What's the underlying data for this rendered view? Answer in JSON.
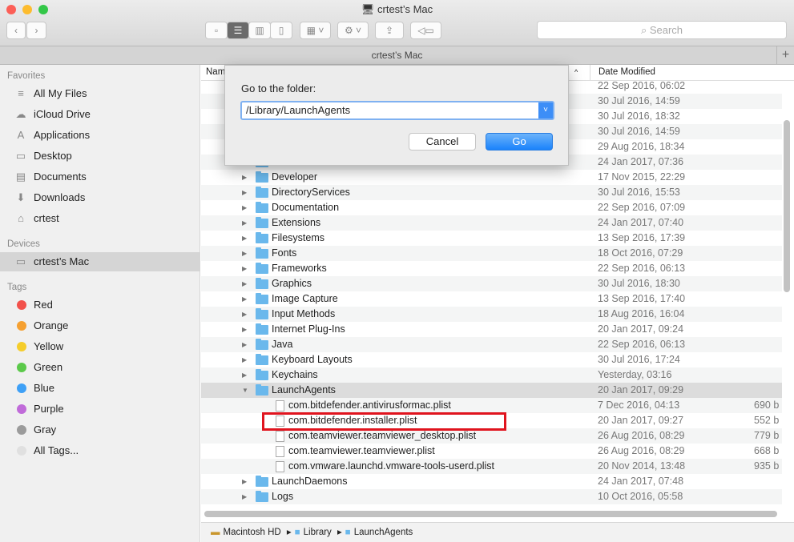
{
  "window": {
    "title": "crtest’s Mac",
    "tab": "crtest’s Mac",
    "search_placeholder": "Search"
  },
  "sidebar": {
    "favorites_header": "Favorites",
    "favorites": [
      {
        "label": "All My Files",
        "icon": "≡"
      },
      {
        "label": "iCloud Drive",
        "icon": "☁"
      },
      {
        "label": "Applications",
        "icon": "A"
      },
      {
        "label": "Desktop",
        "icon": "▭"
      },
      {
        "label": "Documents",
        "icon": "▤"
      },
      {
        "label": "Downloads",
        "icon": "⬇"
      },
      {
        "label": "crtest",
        "icon": "⌂"
      }
    ],
    "devices_header": "Devices",
    "devices": [
      {
        "label": "crtest’s Mac",
        "icon": "▭"
      }
    ],
    "tags_header": "Tags",
    "tags": [
      {
        "label": "Red",
        "color": "#f2514b"
      },
      {
        "label": "Orange",
        "color": "#f5a031"
      },
      {
        "label": "Yellow",
        "color": "#f5cd2b"
      },
      {
        "label": "Green",
        "color": "#5bc94a"
      },
      {
        "label": "Blue",
        "color": "#3ea0f6"
      },
      {
        "label": "Purple",
        "color": "#c06bd9"
      },
      {
        "label": "Gray",
        "color": "#9b9b9b"
      },
      {
        "label": "All Tags...",
        "color": "#e0e0e0"
      }
    ]
  },
  "columns": {
    "name": "Name",
    "date": "Date Modified"
  },
  "rows": [
    {
      "name": "",
      "date": "22 Sep 2016, 06:02",
      "size": "",
      "type": "folder"
    },
    {
      "name": "",
      "date": "30 Jul 2016, 14:59",
      "size": "",
      "type": "folder"
    },
    {
      "name": "",
      "date": "30 Jul 2016, 18:32",
      "size": "",
      "type": "folder"
    },
    {
      "name": "",
      "date": "30 Jul 2016, 14:59",
      "size": "",
      "type": "folder"
    },
    {
      "name": "",
      "date": "29 Aug 2016, 18:34",
      "size": "",
      "type": "folder"
    },
    {
      "name": "",
      "date": "24 Jan 2017, 07:36",
      "size": "",
      "type": "folder"
    },
    {
      "name": "Developer",
      "date": "17 Nov 2015, 22:29",
      "size": "",
      "type": "folder"
    },
    {
      "name": "DirectoryServices",
      "date": "30 Jul 2016, 15:53",
      "size": "",
      "type": "folder"
    },
    {
      "name": "Documentation",
      "date": "22 Sep 2016, 07:09",
      "size": "",
      "type": "folder"
    },
    {
      "name": "Extensions",
      "date": "24 Jan 2017, 07:40",
      "size": "",
      "type": "folder"
    },
    {
      "name": "Filesystems",
      "date": "13 Sep 2016, 17:39",
      "size": "",
      "type": "folder"
    },
    {
      "name": "Fonts",
      "date": "18 Oct 2016, 07:29",
      "size": "",
      "type": "folder"
    },
    {
      "name": "Frameworks",
      "date": "22 Sep 2016, 06:13",
      "size": "",
      "type": "folder"
    },
    {
      "name": "Graphics",
      "date": "30 Jul 2016, 18:30",
      "size": "",
      "type": "folder"
    },
    {
      "name": "Image Capture",
      "date": "13 Sep 2016, 17:40",
      "size": "",
      "type": "folder"
    },
    {
      "name": "Input Methods",
      "date": "18 Aug 2016, 16:04",
      "size": "",
      "type": "folder"
    },
    {
      "name": "Internet Plug-Ins",
      "date": "20 Jan 2017, 09:24",
      "size": "",
      "type": "folder"
    },
    {
      "name": "Java",
      "date": "22 Sep 2016, 06:13",
      "size": "",
      "type": "folder"
    },
    {
      "name": "Keyboard Layouts",
      "date": "30 Jul 2016, 17:24",
      "size": "",
      "type": "folder"
    },
    {
      "name": "Keychains",
      "date": "Yesterday, 03:16",
      "size": "",
      "type": "folder"
    },
    {
      "name": "LaunchAgents",
      "date": "20 Jan 2017, 09:29",
      "size": "",
      "type": "open"
    },
    {
      "name": "com.bitdefender.antivirusformac.plist",
      "date": "7 Dec 2016, 04:13",
      "size": "690 b",
      "type": "file"
    },
    {
      "name": "com.bitdefender.installer.plist",
      "date": "20 Jan 2017, 09:27",
      "size": "552 b",
      "type": "file"
    },
    {
      "name": "com.teamviewer.teamviewer_desktop.plist",
      "date": "26 Aug 2016, 08:29",
      "size": "779 b",
      "type": "file"
    },
    {
      "name": "com.teamviewer.teamviewer.plist",
      "date": "26 Aug 2016, 08:29",
      "size": "668 b",
      "type": "file"
    },
    {
      "name": "com.vmware.launchd.vmware-tools-userd.plist",
      "date": "20 Nov 2014, 13:48",
      "size": "935 b",
      "type": "file"
    },
    {
      "name": "LaunchDaemons",
      "date": "24 Jan 2017, 07:48",
      "size": "",
      "type": "folder"
    },
    {
      "name": "Logs",
      "date": "10 Oct 2016, 05:58",
      "size": "",
      "type": "folder"
    }
  ],
  "pathbar": [
    "Macintosh HD",
    "Library",
    "LaunchAgents"
  ],
  "dialog": {
    "label": "Go to the folder:",
    "value": "/Library/LaunchAgents",
    "cancel": "Cancel",
    "go": "Go"
  },
  "accent": "#3d8ef7"
}
